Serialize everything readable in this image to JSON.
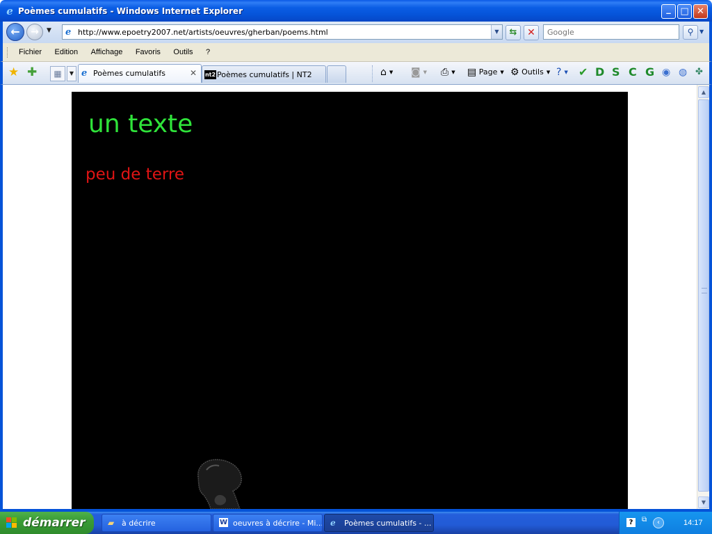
{
  "window": {
    "title": "Poèmes cumulatifs - Windows Internet Explorer"
  },
  "address": {
    "url": "http://www.epoetry2007.net/artists/oeuvres/gherban/poems.html",
    "search_placeholder": "Google"
  },
  "menu": {
    "items": [
      "Fichier",
      "Edition",
      "Affichage",
      "Favoris",
      "Outils",
      "?"
    ]
  },
  "tabs": [
    {
      "label": "Poèmes cumulatifs"
    },
    {
      "label": "Poèmes cumulatifs | NT2"
    }
  ],
  "commandbar": {
    "page_label": "Page",
    "tools_label": "Outils",
    "letters": [
      "D",
      "S",
      "C",
      "G"
    ]
  },
  "content": {
    "line1": "un texte",
    "line2": "peu de terre",
    "colors": {
      "stage": "#000000",
      "line1": "#2fe33a",
      "line2": "#e01414"
    }
  },
  "taskbar": {
    "start_label": "démarrer",
    "items": [
      {
        "label": "à décrire",
        "icon": "folder-icon"
      },
      {
        "label": "oeuvres à décrire - Mi...",
        "icon": "word-icon"
      },
      {
        "label": "Poèmes cumulatifs - ...",
        "icon": "ie-icon"
      }
    ],
    "clock": "14:17"
  }
}
